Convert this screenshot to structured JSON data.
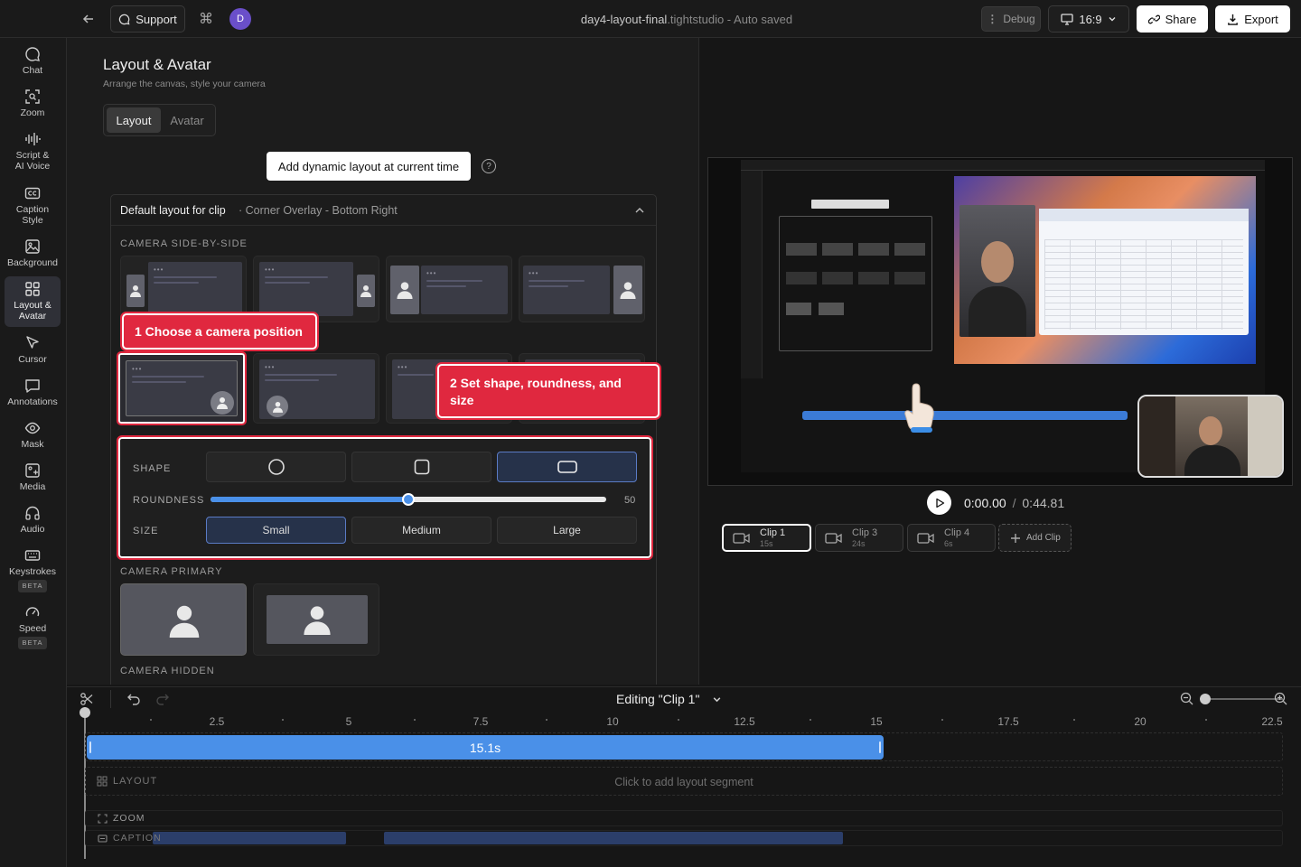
{
  "topbar": {
    "support_label": "Support",
    "cmd_glyph": "⌘",
    "avatar_initial": "D",
    "file_name": "day4-layout-final",
    "file_ext": ".tightstudio",
    "save_status": " - Auto saved",
    "debug_label": "Debug",
    "aspect_label": "16:9",
    "share_label": "Share",
    "export_label": "Export"
  },
  "sidebar": {
    "items": [
      {
        "label": "Chat",
        "icon": "chat-bubble-icon"
      },
      {
        "label": "Zoom",
        "icon": "zoom-icon"
      },
      {
        "label": "Script &\nAI Voice",
        "icon": "waveform-icon"
      },
      {
        "label": "Caption\nStyle",
        "icon": "caption-icon"
      },
      {
        "label": "Background",
        "icon": "image-icon"
      },
      {
        "label": "Layout &\nAvatar",
        "icon": "grid-icon"
      },
      {
        "label": "Cursor",
        "icon": "cursor-icon"
      },
      {
        "label": "Annotations",
        "icon": "annotation-icon"
      },
      {
        "label": "Mask",
        "icon": "eye-icon"
      },
      {
        "label": "Media",
        "icon": "media-icon"
      },
      {
        "label": "Audio",
        "icon": "headphones-icon"
      },
      {
        "label": "Keystrokes",
        "icon": "keyboard-icon",
        "badge": "BETA"
      },
      {
        "label": "Speed",
        "icon": "gauge-icon",
        "badge": "BETA"
      }
    ]
  },
  "panel": {
    "title": "Layout & Avatar",
    "subtitle": "Arrange the canvas, style your camera",
    "tabs": [
      "Layout",
      "Avatar"
    ],
    "add_dynamic_label": "Add dynamic layout at current time",
    "default_layout_label": "Default layout for clip",
    "default_layout_value": "· Corner Overlay - Bottom Right",
    "side_by_side_label": "CAMERA SIDE-BY-SIDE",
    "callout1": "1 Choose a camera position",
    "callout2": "2 Set shape, roundness, and size",
    "shape_label": "SHAPE",
    "roundness_label": "ROUNDNESS",
    "roundness_value": "50",
    "size_label": "SIZE",
    "size_options": [
      "Small",
      "Medium",
      "Large"
    ],
    "camera_primary_label": "CAMERA PRIMARY",
    "camera_hidden_label": "CAMERA HIDDEN"
  },
  "player": {
    "current_time": "0:00.00",
    "separator": "/",
    "total_time": "0:44.81",
    "clips": [
      {
        "name": "Clip 1",
        "dur": "15s"
      },
      {
        "name": "Clip 3",
        "dur": "24s"
      },
      {
        "name": "Clip 4",
        "dur": "6s"
      }
    ],
    "add_clip_label": "Add Clip"
  },
  "timeline": {
    "editing_label": "Editing \"Clip 1\"",
    "ticks": [
      "2.5",
      "5",
      "7.5",
      "10",
      "12.5",
      "15",
      "17.5",
      "20",
      "22.5"
    ],
    "clip_duration_label": "15.1s",
    "layout_track_label": "LAYOUT",
    "layout_hint": "Click to add layout segment",
    "zoom_track_label": "ZOOM",
    "caption_track_label": "CAPTION"
  }
}
